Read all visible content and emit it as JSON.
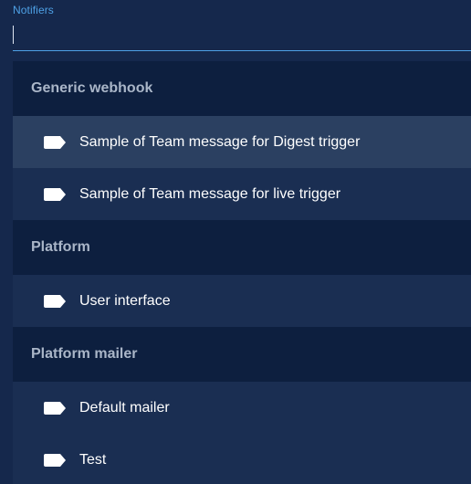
{
  "field": {
    "label": "Notifiers",
    "value": ""
  },
  "groups": [
    {
      "header": "Generic webhook",
      "items": [
        {
          "label": "Sample of Team message for Digest trigger",
          "active": true
        },
        {
          "label": "Sample of Team message for live trigger",
          "active": false
        }
      ]
    },
    {
      "header": "Platform",
      "items": [
        {
          "label": "User interface",
          "active": false
        }
      ]
    },
    {
      "header": "Platform mailer",
      "items": [
        {
          "label": "Default mailer",
          "active": false
        },
        {
          "label": "Test",
          "active": false
        }
      ]
    }
  ],
  "colors": {
    "accent": "#4ea1e6",
    "background": "#15284c",
    "group_header_bg": "#0d1f3f",
    "option_bg": "#1a2e52",
    "option_active_bg": "#2b4061"
  },
  "icons": {
    "option_icon": "tag-icon"
  }
}
